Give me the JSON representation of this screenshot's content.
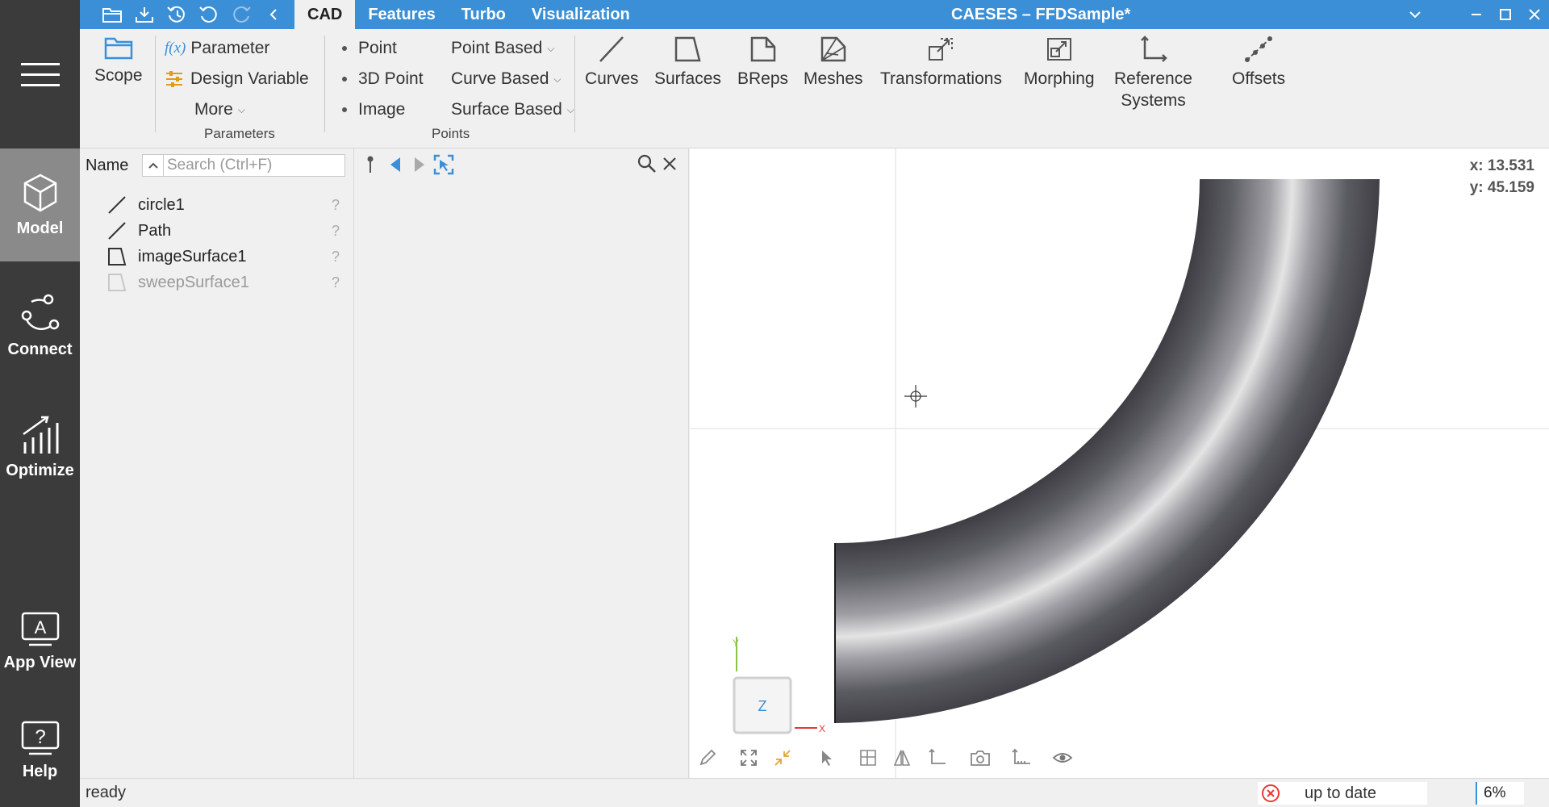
{
  "app": {
    "title": "CAESES  –  FFDSample*",
    "accent": "#3a8fd6"
  },
  "titlebar": {
    "icons": [
      "open-folder-icon",
      "save-download-icon",
      "history-icon",
      "undo-icon",
      "redo-icon",
      "collapse-left-icon"
    ],
    "tabs": [
      {
        "label": "CAD",
        "active": true
      },
      {
        "label": "Features"
      },
      {
        "label": "Turbo"
      },
      {
        "label": "Visualization"
      }
    ]
  },
  "sidebar": {
    "items": [
      {
        "label": "Model",
        "icon": "cube-icon",
        "active": true
      },
      {
        "label": "Connect",
        "icon": "connect-icon"
      },
      {
        "label": "Optimize",
        "icon": "chart-icon"
      },
      {
        "label": "App View",
        "icon": "app-view-icon"
      },
      {
        "label": "Help",
        "icon": "help-icon"
      }
    ]
  },
  "ribbon": {
    "scope_label": "Scope",
    "parameter_label": "Parameter",
    "parameter_fx": "f(x)",
    "design_variable_label": "Design Variable",
    "more_label": "More",
    "parameters_group": "Parameters",
    "point_label": "Point",
    "point3d_label": "3D Point",
    "image_label": "Image",
    "point_based_label": "Point Based",
    "curve_based_label": "Curve Based",
    "surface_based_label": "Surface Based",
    "points_group": "Points",
    "curves_label": "Curves",
    "surfaces_label": "Surfaces",
    "breps_label": "BReps",
    "meshes_label": "Meshes",
    "transformations_label": "Transformations",
    "morphing_label": "Morphing",
    "reference_systems_label": "Reference\nSystems",
    "offsets_label": "Offsets"
  },
  "tree": {
    "header_name": "Name",
    "search_placeholder": "Search (Ctrl+F)",
    "items": [
      {
        "label": "circle1",
        "icon": "curve-icon",
        "status": "?"
      },
      {
        "label": "Path",
        "icon": "curve-icon",
        "status": "?"
      },
      {
        "label": "imageSurface1",
        "icon": "surface-icon",
        "status": "?"
      },
      {
        "label": "sweepSurface1",
        "icon": "surface-icon",
        "status": "?",
        "dimmed": true
      }
    ]
  },
  "viewport": {
    "coord_x": "x: 13.531",
    "coord_y": "y: 45.159",
    "axis_y": "Y",
    "axis_x": "X",
    "axis_z": "Z"
  },
  "status": {
    "text": "ready",
    "update_state": "up to date",
    "zoom": "6%"
  }
}
